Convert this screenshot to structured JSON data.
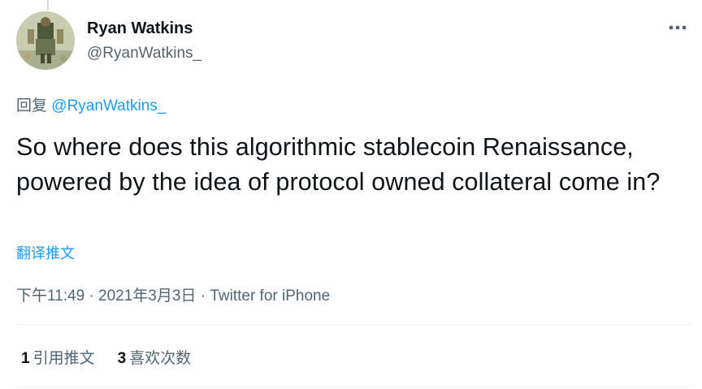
{
  "author": {
    "name": "Ryan Watkins",
    "handle": "@RyanWatkins_"
  },
  "reply": {
    "prefix": "回复",
    "mention": "@RyanWatkins_"
  },
  "tweet": {
    "text": "So where does this algorithmic stablecoin Renaissance, powered by the idea of protocol owned collateral come in?"
  },
  "translate_label": "翻译推文",
  "meta": {
    "time": "下午11:49",
    "sep1": " · ",
    "date": "2021年3月3日",
    "sep2": " · ",
    "source": "Twitter for iPhone"
  },
  "stats": {
    "retweets_count": "1",
    "retweets_label": "引用推文",
    "likes_count": "3",
    "likes_label": "喜欢次数"
  },
  "icons": {
    "more": "more-horizontal-icon"
  }
}
